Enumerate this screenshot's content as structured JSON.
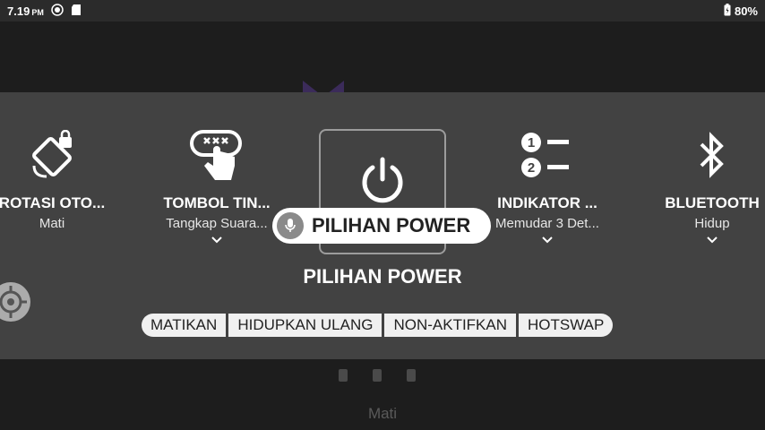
{
  "status_bar": {
    "time": "7.19",
    "ampm": "PM",
    "battery": "80%",
    "icons": [
      "brightness-icon",
      "sd-card-icon",
      "battery-icon"
    ]
  },
  "background": {
    "mati_label": "Mati"
  },
  "tiles": [
    {
      "title": "ROTASI OTO...",
      "sub": "Mati",
      "icon": "rotate-lock-icon"
    },
    {
      "title": "TOMBOL TIN...",
      "sub": "Tangkap Suara...",
      "icon": "tap-gesture-icon"
    },
    {
      "title": "INDIKATOR ...",
      "sub": "Memudar 3 Det...",
      "icon": "numbered-list-icon"
    },
    {
      "title": "BLUETOOTH",
      "sub": "Hidup",
      "icon": "bluetooth-icon"
    }
  ],
  "selected": {
    "label": "PILIHAN POWER",
    "icon": "power-icon"
  },
  "tooltip": {
    "label": "PILIHAN POWER",
    "icon": "mic-icon"
  },
  "options": [
    "MATIKAN",
    "HIDUPKAN ULANG",
    "NON-AKTIFKAN",
    "HOTSWAP"
  ],
  "colors": {
    "panel": "#424242",
    "status_bar": "#2b2b2b",
    "option_bg": "#f0f0f0"
  }
}
